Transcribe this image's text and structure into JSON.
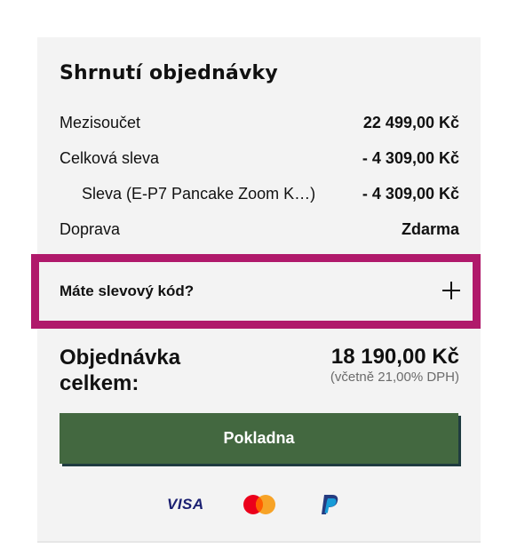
{
  "summary": {
    "title": "Shrnutí objednávky",
    "rows": [
      {
        "label": "Mezisoučet",
        "value": "22 499,00 Kč"
      },
      {
        "label": "Celková sleva",
        "value": "- 4 309,00 Kč"
      },
      {
        "label": "Sleva (E-P7 Pancake Zoom K…)",
        "value": "- 4 309,00 Kč"
      },
      {
        "label": "Doprava",
        "value": "Zdarma"
      }
    ]
  },
  "coupon": {
    "label": "Máte slevový kód?",
    "icon": "plus-icon"
  },
  "total": {
    "label": "Objednávka celkem:",
    "value": "18 190,00 Kč",
    "vat_note": "(včetně 21,00% DPH)"
  },
  "checkout": {
    "label": "Pokladna",
    "color": "#436840"
  },
  "payment_methods": {
    "visa_text": "VISA",
    "icons": [
      "visa-icon",
      "mastercard-icon",
      "paypal-icon"
    ]
  },
  "colors": {
    "highlight_border": "#b0196b",
    "panel_bg": "#f3f3f3"
  }
}
